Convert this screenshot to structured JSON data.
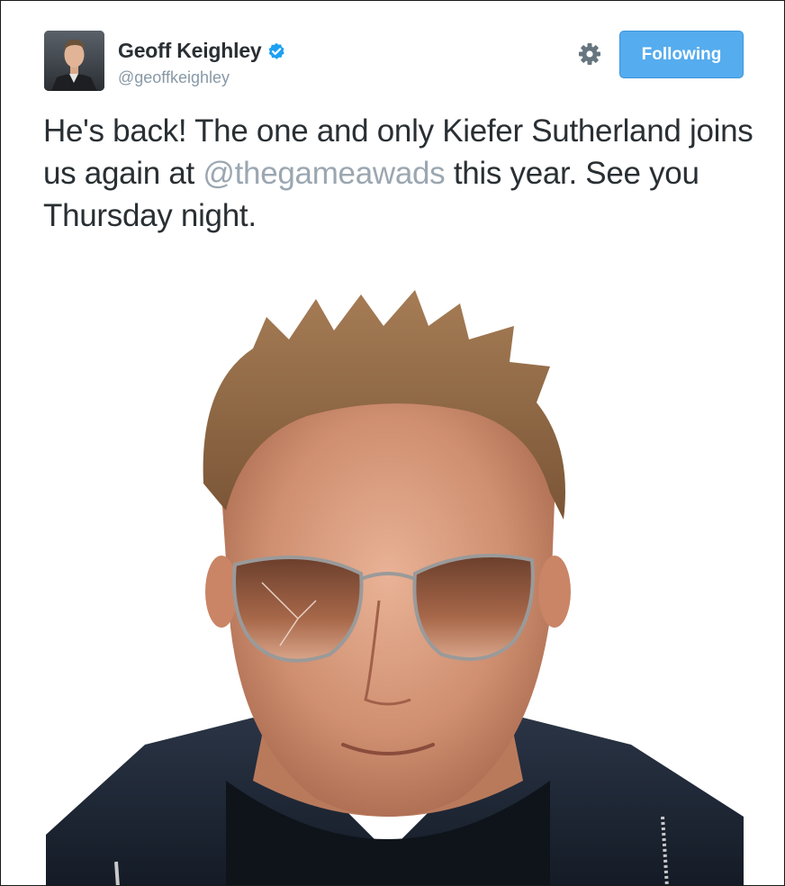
{
  "tweet": {
    "author": {
      "display_name": "Geoff Keighley",
      "handle": "@geoffkeighley",
      "verified": true,
      "avatar_icon": "profile-photo"
    },
    "follow_button_label": "Following",
    "settings_icon": "gear-icon",
    "text_before_mention": "He's back! The one and only Kiefer Sutherland joins us again at ",
    "mention": "@thegameawads",
    "text_after_mention": " this year. See you Thursday night.",
    "media": {
      "type": "photo",
      "subject": "Kiefer Sutherland portrait with aviator sunglasses"
    }
  },
  "colors": {
    "accent": "#55acee",
    "mention": "#9ba7b1",
    "verified_badge": "#1da1f2",
    "text": "#292f33",
    "secondary_text": "#8899a6"
  }
}
